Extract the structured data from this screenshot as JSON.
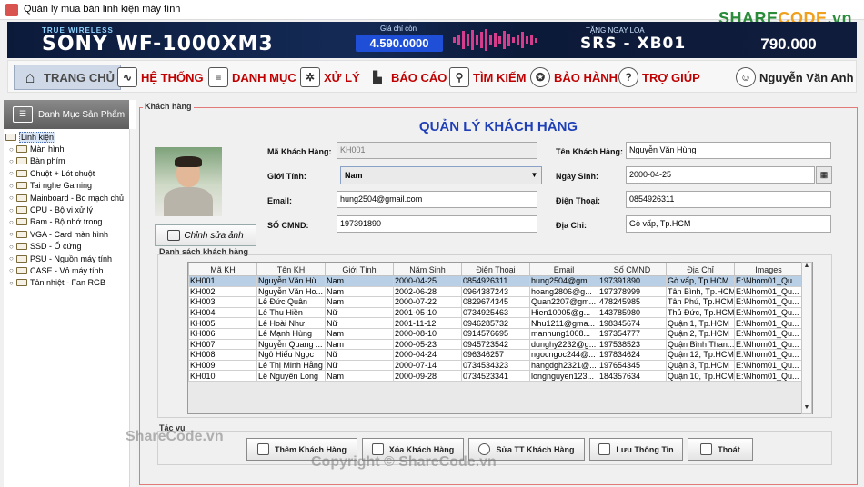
{
  "window": {
    "title": "Quản lý mua bán linh kiện máy tính",
    "watermark_logo": [
      "SHARE",
      "CODE",
      ".vn"
    ]
  },
  "banner": {
    "tagline": "TRUE WIRELESS",
    "product": "SONY WF-1000XM3",
    "price_label": "Giá chỉ còn",
    "price": "4.590.0000",
    "gift_label": "TẶNG NGAY LOA",
    "gift_product": "SRS - XB01",
    "gift_price": "790.000"
  },
  "menu": {
    "home": "TRANG CHỦ",
    "system": "HỆ THỐNG",
    "catalog": "DANH MỤC",
    "process": "XỬ LÝ",
    "report": "BÁO CÁO",
    "search": "TÌM KIẾM",
    "warranty": "BẢO HÀNH",
    "help": "TRỢ GIÚP",
    "user": "Nguyễn Văn Anh"
  },
  "sidebar": {
    "header": "Danh Mục Sản Phẩm",
    "root": "Linh kiện",
    "items": [
      "Màn hình",
      "Bàn phím",
      "Chuột + Lót chuột",
      "Tai nghe Gaming",
      "Mainboard - Bo mạch chủ",
      "CPU - Bộ vi xử lý",
      "Ram - Bộ nhớ trong",
      "VGA - Card màn hình",
      "SSD - Ổ cứng",
      "PSU - Nguồn máy tính",
      "CASE - Vỏ máy tính",
      "Tản nhiệt - Fan RGB"
    ]
  },
  "main": {
    "group_title": "Khách hàng",
    "page_title": "QUẢN LÝ KHÁCH HÀNG",
    "labels": {
      "id": "Mã Khách Hàng:",
      "name": "Tên Khách Hàng:",
      "gender": "Giới Tính:",
      "dob": "Ngày Sinh:",
      "email": "Email:",
      "phone": "Điện Thoại:",
      "idcard": "SỐ CMND:",
      "address": "Địa Chỉ:"
    },
    "values": {
      "id": "KH001",
      "name": "Nguyễn Văn Hùng",
      "gender": "Nam",
      "dob": "2000-04-25",
      "email": "hung2504@gmail.com",
      "phone": "0854926311",
      "idcard": "197391890",
      "address": "Gò vấp, Tp.HCM"
    },
    "edit_photo_button": "Chỉnh sửa ảnh",
    "list_title": "Danh sách khách hàng",
    "actions_title": "Tác vụ",
    "actions": {
      "add": "Thêm Khách Hàng",
      "delete": "Xóa Khách Hàng",
      "edit": "Sửa TT Khách Hàng",
      "save": "Lưu Thông Tin",
      "exit": "Thoát"
    }
  },
  "table": {
    "columns": [
      "Mã KH",
      "Tên KH",
      "Giới Tính",
      "Năm Sinh",
      "Điện Thoại",
      "Email",
      "Số CMND",
      "Địa Chỉ",
      "Images"
    ],
    "rows": [
      [
        "KH001",
        "Nguyễn Văn Hù...",
        "Nam",
        "2000-04-25",
        "0854926311",
        "hung2504@gm...",
        "197391890",
        "Gò vấp, Tp.HCM",
        "E:\\Nhom01_Qu..."
      ],
      [
        "KH002",
        "Nguyễn Văn Ho...",
        "Nam",
        "2002-06-28",
        "0964387243",
        "hoang2806@g...",
        "197378999",
        "Tân Bình, Tp.HCM",
        "E:\\Nhom01_Qu..."
      ],
      [
        "KH003",
        "Lê Đức Quân",
        "Nam",
        "2000-07-22",
        "0829674345",
        "Quan2207@gm...",
        "478245985",
        "Tân Phú, Tp.HCM",
        "E:\\Nhom01_Qu..."
      ],
      [
        "KH004",
        "Lê Thu Hiền",
        "Nữ",
        "2001-05-10",
        "0734925463",
        "Hien10005@g...",
        "143785980",
        "Thủ Đức, Tp.HCM",
        "E:\\Nhom01_Qu..."
      ],
      [
        "KH005",
        "Lê Hoài Như",
        "Nữ",
        "2001-11-12",
        "0946285732",
        "Nhu1211@gma...",
        "198345674",
        "Quận 1, Tp.HCM",
        "E:\\Nhom01_Qu..."
      ],
      [
        "KH006",
        "Lê Mạnh Hùng",
        "Nam",
        "2000-08-10",
        "0914576695",
        "manhung1008...",
        "197354777",
        "Quận 2, Tp.HCM",
        "E:\\Nhom01_Qu..."
      ],
      [
        "KH007",
        "Nguyễn Quang ...",
        "Nam",
        "2000-05-23",
        "0945723542",
        "dunghy2232@g...",
        "197538523",
        "Quận Bình Than...",
        "E:\\Nhom01_Qu..."
      ],
      [
        "KH008",
        "Ngô Hiếu Ngọc",
        "Nữ",
        "2000-04-24",
        "096346257",
        "ngocngoc244@...",
        "197834624",
        "Quận 12, Tp.HCM",
        "E:\\Nhom01_Qu..."
      ],
      [
        "KH009",
        "Lê Thị Minh Hằng",
        "Nữ",
        "2000-07-14",
        "0734534323",
        "hangdgh2321@...",
        "197654345",
        "Quận 3, Tp.HCM",
        "E:\\Nhom01_Qu..."
      ],
      [
        "KH010",
        "Lê Nguyên Long",
        "Nam",
        "2000-09-28",
        "0734523341",
        "longnguyen123...",
        "184357634",
        "Quận 10, Tp.HCM",
        "E:\\Nhom01_Qu..."
      ]
    ]
  },
  "watermarks": {
    "left": "ShareCode.vn",
    "bottom": "Copyright © ShareCode.vn"
  }
}
